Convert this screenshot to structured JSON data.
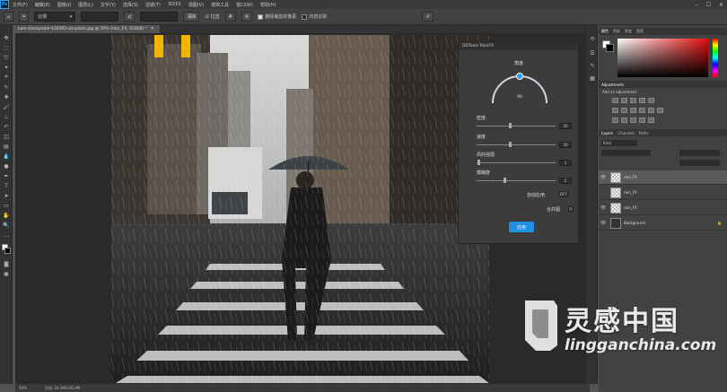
{
  "app": {
    "logo": "Ps"
  },
  "menu": [
    "文件(F)",
    "编辑(E)",
    "图像(I)",
    "图层(L)",
    "文字(Y)",
    "选择(S)",
    "滤镜(T)",
    "3D(D)",
    "视图(V)",
    "增效工具",
    "窗口(W)",
    "帮助(H)"
  ],
  "options": {
    "ratio_label": "比例",
    "clear_label": "清除",
    "straighten_label": "拉直",
    "delete_cropped_label": "删除裁剪的像素",
    "content_aware_label": "内容识别"
  },
  "document": {
    "tab_title": "luke-stackpoole-436565-unsplash.jpg @ 50% (rain_FX, RGB/8) *",
    "zoom": "50%",
    "doc_size": "文档: 24.1M/136.0M"
  },
  "rainfx": {
    "title": "DDTools RainFX",
    "angle_label": "角度",
    "angle_value": "90",
    "density_label": "密度",
    "density_value": "50",
    "speed_label": "速度",
    "speed_value": "50",
    "wind_label": "风的强弱",
    "wind_value": "1",
    "blur_label": "模糊度",
    "blur_value": "5",
    "auto_apply_label": "自动应用",
    "auto_apply_state": "OFF",
    "merge_label": "合并图",
    "apply_label": "应用"
  },
  "panels": {
    "color_tabs": [
      "颜色",
      "色板",
      "渐变",
      "图案"
    ],
    "adjustments_title": "Adjustments",
    "adjustments_hint": "Add an adjustment",
    "layers_tabs": [
      "Layers",
      "Channels",
      "Paths"
    ],
    "layers_kind": "Kind",
    "layers": [
      {
        "name": "rain_FX",
        "selected": true
      },
      {
        "name": "rain_FX",
        "selected": false
      },
      {
        "name": "rain_FX",
        "selected": false
      },
      {
        "name": "Background",
        "selected": false
      }
    ]
  },
  "watermark": {
    "text": "灵感中国",
    "url": "lingganchina.com"
  },
  "colors": {
    "accent": "#1f8fe0",
    "panel_bg": "#424242",
    "dark_bg": "#323232"
  }
}
